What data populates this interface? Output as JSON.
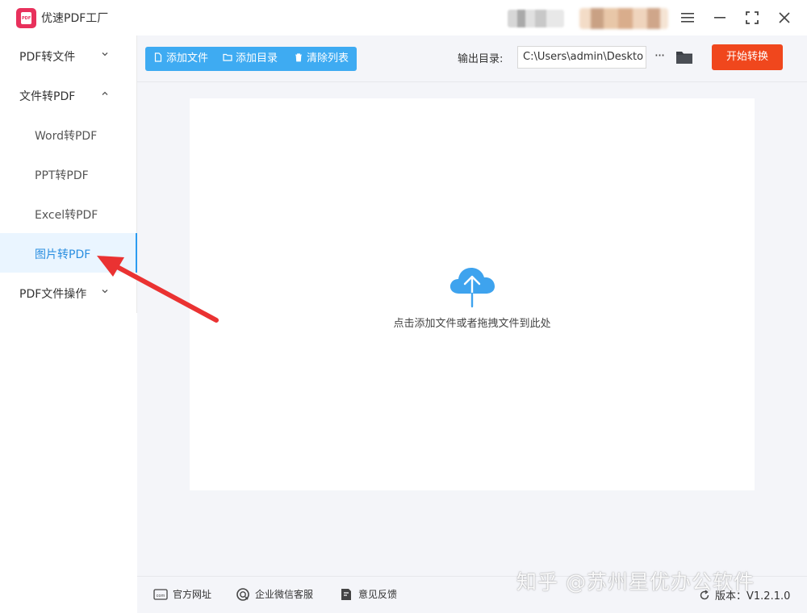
{
  "app": {
    "title": "优速PDF工厂",
    "logo_text": "PDF"
  },
  "window_controls": {
    "menu_icon": "hamburger-menu-icon",
    "minimize_icon": "minimize-icon",
    "maximize_icon": "maximize-icon",
    "close_icon": "close-icon"
  },
  "sidebar": {
    "groups": [
      {
        "label": "PDF转文件",
        "expanded": false
      },
      {
        "label": "文件转PDF",
        "expanded": true,
        "items": [
          {
            "label": "Word转PDF",
            "active": false
          },
          {
            "label": "PPT转PDF",
            "active": false
          },
          {
            "label": "Excel转PDF",
            "active": false
          },
          {
            "label": "图片转PDF",
            "active": true
          }
        ]
      },
      {
        "label": "PDF文件操作",
        "expanded": false
      }
    ]
  },
  "toolbar": {
    "add_file_label": "添加文件",
    "add_folder_label": "添加目录",
    "clear_list_label": "清除列表",
    "output_dir_label": "输出目录:",
    "output_dir_value": "C:\\Users\\admin\\Deskto",
    "more_label": "···",
    "start_label": "开始转换"
  },
  "dropzone": {
    "hint": "点击添加文件或者拖拽文件到此处",
    "icon": "cloud-upload-icon"
  },
  "footer": {
    "website_label": "官方网址",
    "wechat_label": "企业微信客服",
    "feedback_label": "意见反馈",
    "version_label": "版本：V1.2.1.0"
  },
  "watermark": "知乎 @苏州星优办公软件",
  "colors": {
    "accent_blue": "#3eabf2",
    "start_red": "#f0471d",
    "logo_pink": "#e8315c",
    "annotation_red": "#ea3232"
  }
}
